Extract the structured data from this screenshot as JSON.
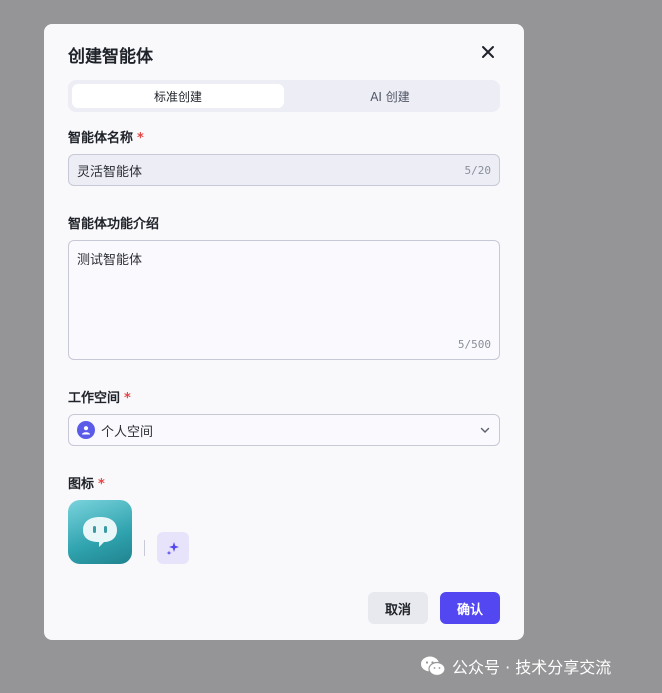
{
  "dialog": {
    "title": "创建智能体"
  },
  "tabs": [
    {
      "label": "标准创建",
      "active": true
    },
    {
      "label": "AI 创建",
      "active": false
    }
  ],
  "fields": {
    "name": {
      "label": "智能体名称",
      "required_mark": "*",
      "value": "灵活智能体",
      "counter": "5/20"
    },
    "description": {
      "label": "智能体功能介绍",
      "value": "测试智能体",
      "counter": "5/500"
    },
    "workspace": {
      "label": "工作空间",
      "required_mark": "*",
      "value": "个人空间"
    },
    "icon": {
      "label": "图标",
      "required_mark": "*"
    }
  },
  "buttons": {
    "cancel": "取消",
    "confirm": "确认"
  },
  "watermark": {
    "text": "公众号 · 技术分享交流"
  },
  "colors": {
    "accent": "#5247f0",
    "required": "#e54545",
    "backdrop": "#959597"
  },
  "icons": [
    "close-icon",
    "user-icon",
    "chevron-down-icon",
    "chat-bubble-icon",
    "sparkle-icon",
    "wechat-icon"
  ]
}
